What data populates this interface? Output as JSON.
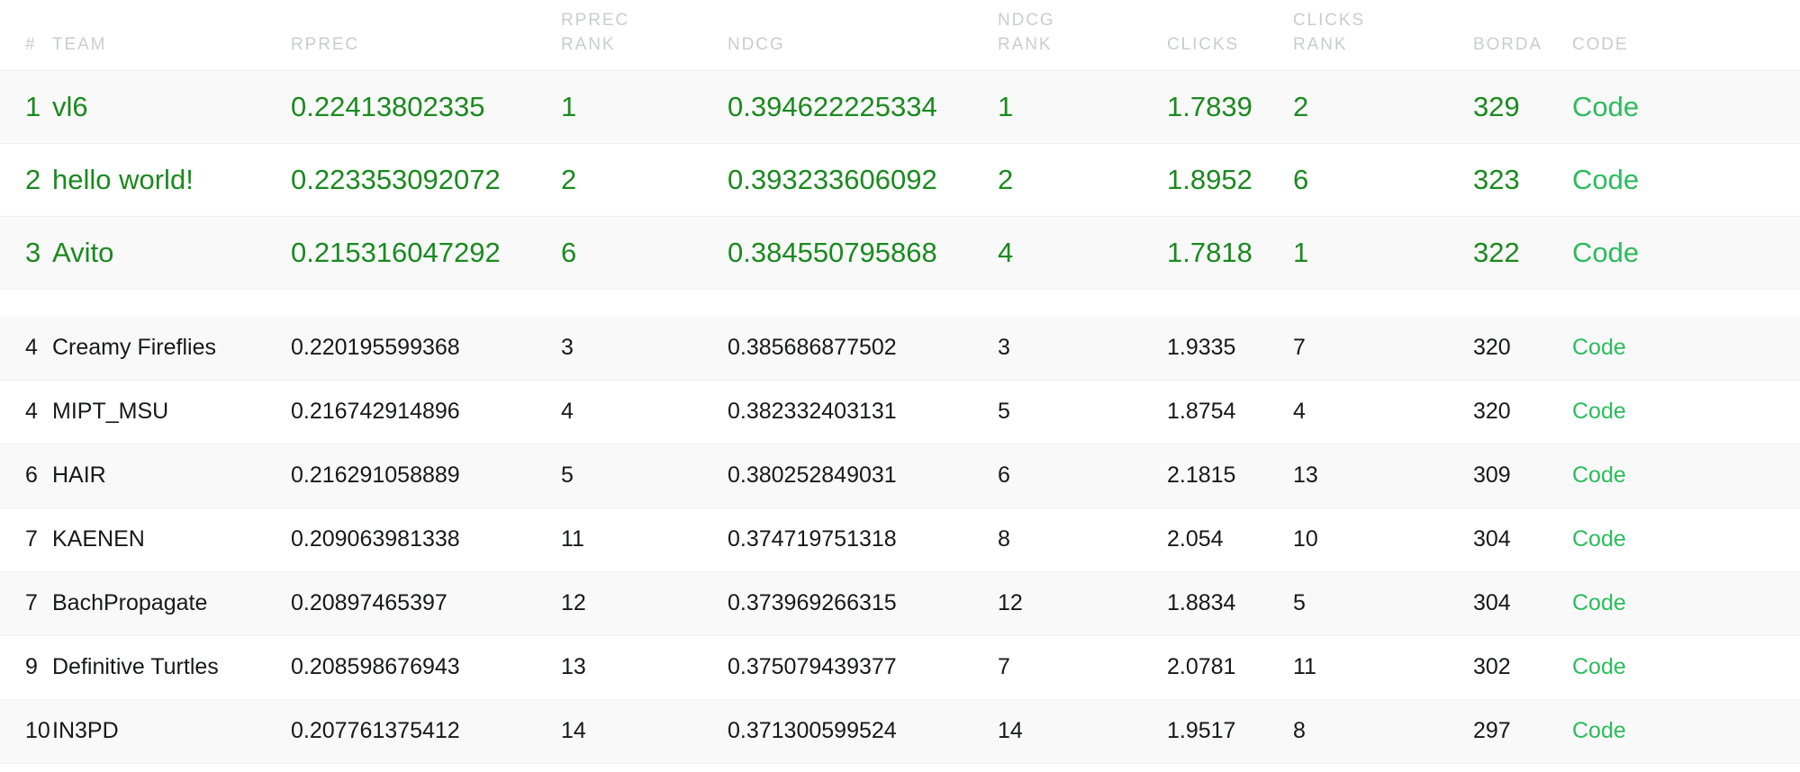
{
  "table": {
    "columns": [
      {
        "key": "rank",
        "label": "#"
      },
      {
        "key": "team",
        "label": "TEAM"
      },
      {
        "key": "rprec",
        "label": "RPREC"
      },
      {
        "key": "rprec_rank",
        "label": "RPREC\nRANK"
      },
      {
        "key": "ndcg",
        "label": "NDCG"
      },
      {
        "key": "ndcg_rank",
        "label": "NDCG\nRANK"
      },
      {
        "key": "clicks",
        "label": "CLICKS"
      },
      {
        "key": "clicks_rank",
        "label": "CLICKS\nRANK"
      },
      {
        "key": "borda",
        "label": "BORDA"
      },
      {
        "key": "code",
        "label": "CODE"
      }
    ],
    "code_link_label": "Code",
    "colors": {
      "header_text": "#c9cccf",
      "top_row_text": "#1a8a1e",
      "body_text": "#16181a",
      "code_link": "#2cbc5d",
      "row_alt_bg": "#f9f9f9",
      "row_bg": "#ffffff",
      "row_border": "#f0f0f0"
    },
    "rows": [
      {
        "rank": "1",
        "team": "vl6",
        "rprec": "0.22413802335",
        "rprec_rank": "1",
        "ndcg": "0.394622225334",
        "ndcg_rank": "1",
        "clicks": "1.7839",
        "clicks_rank": "2",
        "borda": "329",
        "code": "Code",
        "highlight": true
      },
      {
        "rank": "2",
        "team": "hello world!",
        "rprec": "0.223353092072",
        "rprec_rank": "2",
        "ndcg": "0.393233606092",
        "ndcg_rank": "2",
        "clicks": "1.8952",
        "clicks_rank": "6",
        "borda": "323",
        "code": "Code",
        "highlight": true
      },
      {
        "rank": "3",
        "team": "Avito",
        "rprec": "0.215316047292",
        "rprec_rank": "6",
        "ndcg": "0.384550795868",
        "ndcg_rank": "4",
        "clicks": "1.7818",
        "clicks_rank": "1",
        "borda": "322",
        "code": "Code",
        "highlight": true
      },
      {
        "rank": "4",
        "team": "Creamy Fireflies",
        "rprec": "0.220195599368",
        "rprec_rank": "3",
        "ndcg": "0.385686877502",
        "ndcg_rank": "3",
        "clicks": "1.9335",
        "clicks_rank": "7",
        "borda": "320",
        "code": "Code",
        "highlight": false
      },
      {
        "rank": "4",
        "team": "MIPT_MSU",
        "rprec": "0.216742914896",
        "rprec_rank": "4",
        "ndcg": "0.382332403131",
        "ndcg_rank": "5",
        "clicks": "1.8754",
        "clicks_rank": "4",
        "borda": "320",
        "code": "Code",
        "highlight": false
      },
      {
        "rank": "6",
        "team": "HAIR",
        "rprec": "0.216291058889",
        "rprec_rank": "5",
        "ndcg": "0.380252849031",
        "ndcg_rank": "6",
        "clicks": "2.1815",
        "clicks_rank": "13",
        "borda": "309",
        "code": "Code",
        "highlight": false
      },
      {
        "rank": "7",
        "team": "KAENEN",
        "rprec": "0.209063981338",
        "rprec_rank": "11",
        "ndcg": "0.374719751318",
        "ndcg_rank": "8",
        "clicks": "2.054",
        "clicks_rank": "10",
        "borda": "304",
        "code": "Code",
        "highlight": false
      },
      {
        "rank": "7",
        "team": "BachPropagate",
        "rprec": "0.20897465397",
        "rprec_rank": "12",
        "ndcg": "0.373969266315",
        "ndcg_rank": "12",
        "clicks": "1.8834",
        "clicks_rank": "5",
        "borda": "304",
        "code": "Code",
        "highlight": false
      },
      {
        "rank": "9",
        "team": "Definitive Turtles",
        "rprec": "0.208598676943",
        "rprec_rank": "13",
        "ndcg": "0.375079439377",
        "ndcg_rank": "7",
        "clicks": "2.0781",
        "clicks_rank": "11",
        "borda": "302",
        "code": "Code",
        "highlight": false
      },
      {
        "rank": "10",
        "team": "IN3PD",
        "rprec": "0.207761375412",
        "rprec_rank": "14",
        "ndcg": "0.371300599524",
        "ndcg_rank": "14",
        "clicks": "1.9517",
        "clicks_rank": "8",
        "borda": "297",
        "code": "Code",
        "highlight": false
      }
    ]
  }
}
